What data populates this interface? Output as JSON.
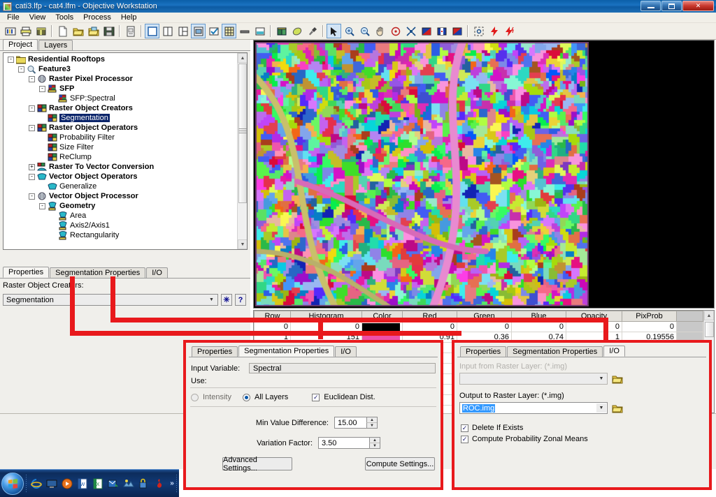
{
  "window": {
    "title": "cati3.lfp - cat4.lfm - Objective Workstation",
    "icon": "app-icon",
    "minimize": "minimize-button",
    "maximize": "maximize-button",
    "close": "✕"
  },
  "menu": {
    "items": [
      "File",
      "View",
      "Tools",
      "Process",
      "Help"
    ]
  },
  "toolbar": {
    "groups": [
      {
        "icons": [
          "project-icon",
          "print-icon",
          "package-icon"
        ]
      },
      {
        "icons": [
          "new-file-icon",
          "open-folder-icon",
          "open-image-icon",
          "save-icon"
        ]
      },
      {
        "icons": [
          "report-icon"
        ]
      },
      {
        "icons": [
          "view-single-icon",
          "view-split-vertical-icon",
          "view-split-left-icon",
          "view-image-icon",
          "view-check-icon",
          "view-table-icon",
          "view-line-icon",
          "view-tray-icon"
        ]
      },
      {
        "icons": [
          "book-icon",
          "eraser-icon",
          "hammer-icon"
        ]
      },
      {
        "icons": [
          "arrow-select-icon",
          "zoom-in-icon",
          "zoom-out-icon",
          "pan-hand-icon",
          "target-icon",
          "fit-icon",
          "swipe-icon",
          "flicker-icon",
          "blend-icon"
        ]
      },
      {
        "icons": [
          "inquire-icon",
          "run-icon",
          "run-all-icon"
        ]
      }
    ]
  },
  "left_panel": {
    "tabs": [
      {
        "label": "Project",
        "selected": true
      },
      {
        "label": "Layers",
        "selected": false
      }
    ],
    "tree": [
      {
        "label": "Residential Rooftops",
        "indent": 0,
        "expander": "-",
        "icon": "folder-icon",
        "bold": true,
        "selected": false
      },
      {
        "label": "Feature3",
        "indent": 1,
        "expander": "-",
        "icon": "magnifier-icon",
        "bold": true,
        "selected": false
      },
      {
        "label": "Raster Pixel Processor",
        "indent": 2,
        "expander": "-",
        "icon": "pixel-processor-icon",
        "bold": true,
        "selected": false
      },
      {
        "label": "SFP",
        "indent": 3,
        "expander": "-",
        "icon": "sfp-icon",
        "bold": true,
        "selected": false
      },
      {
        "label": "SFP:Spectral",
        "indent": 4,
        "expander": "",
        "icon": "sfp-icon",
        "bold": false,
        "selected": false
      },
      {
        "label": "Raster Object Creators",
        "indent": 2,
        "expander": "-",
        "icon": "raster-object-icon",
        "bold": true,
        "selected": false
      },
      {
        "label": "Segmentation",
        "indent": 3,
        "expander": "",
        "icon": "raster-object-icon",
        "bold": false,
        "selected": true
      },
      {
        "label": "Raster Object Operators",
        "indent": 2,
        "expander": "-",
        "icon": "raster-object-icon",
        "bold": true,
        "selected": false
      },
      {
        "label": "Probability Filter",
        "indent": 3,
        "expander": "",
        "icon": "raster-object-icon",
        "bold": false,
        "selected": false
      },
      {
        "label": "Size Filter",
        "indent": 3,
        "expander": "",
        "icon": "raster-object-icon",
        "bold": false,
        "selected": false
      },
      {
        "label": "ReClump",
        "indent": 3,
        "expander": "",
        "icon": "raster-object-icon",
        "bold": false,
        "selected": false
      },
      {
        "label": "Raster To Vector Conversion",
        "indent": 2,
        "expander": "+",
        "icon": "raster-to-vector-icon",
        "bold": true,
        "selected": false
      },
      {
        "label": "Vector Object Operators",
        "indent": 2,
        "expander": "-",
        "icon": "vector-object-icon",
        "bold": true,
        "selected": false
      },
      {
        "label": "Generalize",
        "indent": 3,
        "expander": "",
        "icon": "vector-object-icon",
        "bold": false,
        "selected": false
      },
      {
        "label": "Vector Object Processor",
        "indent": 2,
        "expander": "-",
        "icon": "vector-processor-icon",
        "bold": true,
        "selected": false
      },
      {
        "label": "Geometry",
        "indent": 3,
        "expander": "-",
        "icon": "geometry-icon",
        "bold": true,
        "selected": false
      },
      {
        "label": "Area",
        "indent": 4,
        "expander": "",
        "icon": "geometry-icon",
        "bold": false,
        "selected": false
      },
      {
        "label": "Axis2/Axis1",
        "indent": 4,
        "expander": "",
        "icon": "geometry-icon",
        "bold": false,
        "selected": false
      },
      {
        "label": "Rectangularity",
        "indent": 4,
        "expander": "",
        "icon": "geometry-icon",
        "bold": false,
        "selected": false
      }
    ],
    "properties": {
      "tabs": [
        {
          "label": "Properties",
          "selected": true
        },
        {
          "label": "Segmentation Properties",
          "selected": false
        },
        {
          "label": "I/O",
          "selected": false
        }
      ],
      "field_label": "Raster Object Creators:",
      "combo_value": "Segmentation",
      "combo_arrow": "▼",
      "star_button": "✳",
      "help_button": "?"
    }
  },
  "table": {
    "columns": [
      "Row",
      "Histogram",
      "Color",
      "Red",
      "Green",
      "Blue",
      "Opacity",
      "PixProb"
    ],
    "rows": [
      {
        "Row": "0",
        "Histogram": "0",
        "Color": "#000000",
        "Red": "0",
        "Green": "0",
        "Blue": "0",
        "Opacity": "0",
        "PixProb": "0"
      },
      {
        "Row": "1",
        "Histogram": "151",
        "Color": "#ef4fa8",
        "Red": "0.91",
        "Green": "0.36",
        "Blue": "0.74",
        "Opacity": "1",
        "PixProb": "0.19556"
      }
    ]
  },
  "dialog_segmentation": {
    "tabs": [
      {
        "label": "Properties",
        "selected": false
      },
      {
        "label": "Segmentation Properties",
        "selected": true
      },
      {
        "label": "I/O",
        "selected": false
      }
    ],
    "input_variable_label": "Input Variable:",
    "input_variable_value": "Spectral",
    "use_label": "Use:",
    "radio_intensity": "Intensity",
    "radio_all_layers": "All Layers",
    "checkbox_euclidean": "Euclidean Dist.",
    "euclidean_checked": true,
    "intensity_selected": false,
    "all_layers_selected": true,
    "min_value_difference_label": "Min Value Difference:",
    "min_value_difference": "15.00",
    "variation_factor_label": "Variation Factor:",
    "variation_factor": "3.50",
    "advanced_settings_button": "Advanced Settings...",
    "compute_settings_button": "Compute Settings..."
  },
  "dialog_io": {
    "tabs": [
      {
        "label": "Properties",
        "selected": false
      },
      {
        "label": "Segmentation Properties",
        "selected": false
      },
      {
        "label": "I/O",
        "selected": true
      }
    ],
    "input_label": "Input from Raster Layer: (*.img)",
    "input_value": "",
    "output_label": "Output to Raster Layer: (*.img)",
    "output_value": "ROC.img",
    "checkbox_delete": "Delete If Exists",
    "delete_checked": true,
    "checkbox_zonal": "Compute Probability Zonal Means",
    "zonal_checked": true,
    "browse_icon": "folder-browse-icon",
    "dropdown_arrow": "▼"
  },
  "annotation": {
    "color": "#e8191c"
  },
  "taskbar": {
    "start_button": "start-orb",
    "quick_launch": [
      "internet-explorer-icon",
      "show-desktop-icon",
      "media-player-icon",
      "word-icon",
      "excel-icon",
      "outlook-icon",
      "erdas-icon",
      "security-icon",
      "acrobat-icon"
    ],
    "overflow": "»"
  }
}
